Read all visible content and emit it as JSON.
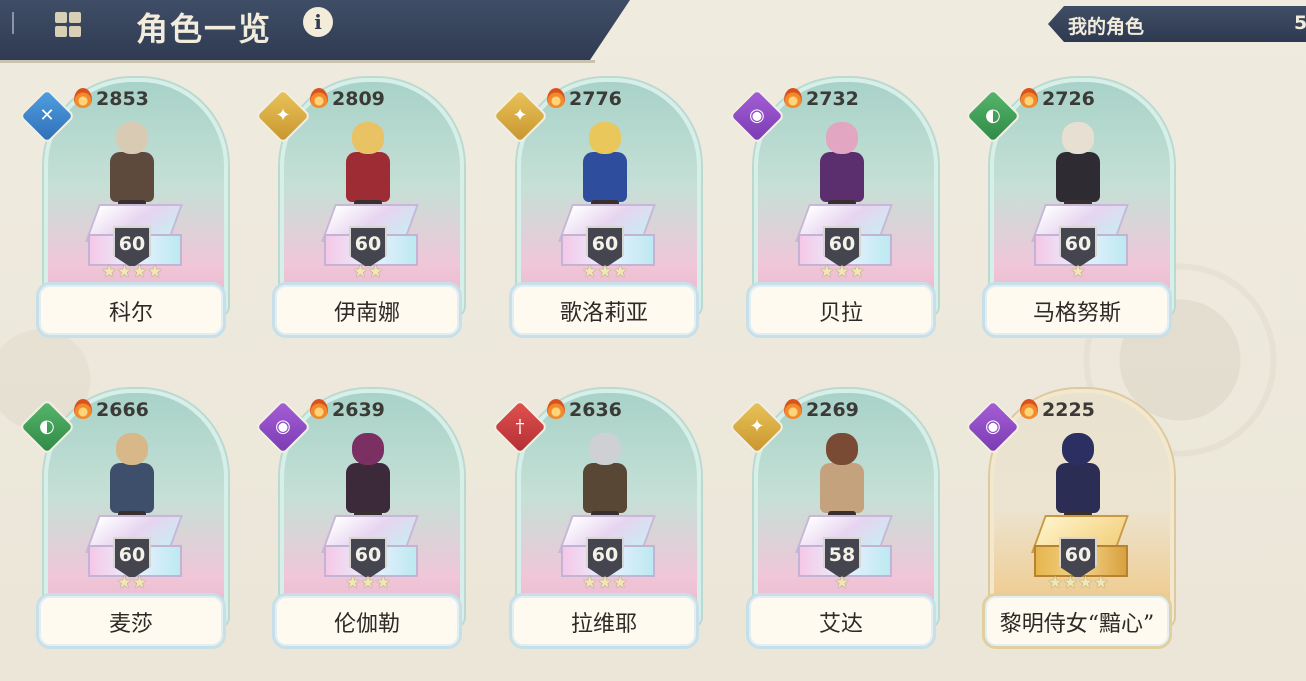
{
  "header": {
    "title": "角色一览",
    "info_icon": "info-icon",
    "menu_icon": "grid-menu-icon"
  },
  "my_characters": {
    "label": "我的角色",
    "count": "5"
  },
  "colors": {
    "header_bg": "#34405a",
    "card_teal": "#a8d2c8",
    "card_gold": "#efcf98",
    "element_wind": "#3f86cf",
    "element_light": "#d6ab43",
    "element_dark": "#8f4dc4",
    "element_earth": "#42a058",
    "element_fire": "#c93f42"
  },
  "characters": [
    {
      "name": "科尔",
      "power": "2853",
      "level": "60",
      "stars": "★★★★",
      "element": "wind",
      "hair": "#d9cbb3",
      "outfit": "#5e4a3c",
      "gold": false
    },
    {
      "name": "伊南娜",
      "power": "2809",
      "level": "60",
      "stars": "★★",
      "element": "light",
      "hair": "#e9c264",
      "outfit": "#9e2c35",
      "gold": false
    },
    {
      "name": "歌洛莉亚",
      "power": "2776",
      "level": "60",
      "stars": "★★★",
      "element": "light",
      "hair": "#e9c75a",
      "outfit": "#2e4d9c",
      "gold": false
    },
    {
      "name": "贝拉",
      "power": "2732",
      "level": "60",
      "stars": "★★★",
      "element": "dark",
      "hair": "#e2a6c2",
      "outfit": "#5b2f6e",
      "gold": false
    },
    {
      "name": "马格努斯",
      "power": "2726",
      "level": "60",
      "stars": "★",
      "element": "earth",
      "hair": "#e7dfd1",
      "outfit": "#2e2b33",
      "gold": false
    },
    {
      "name": "麦莎",
      "power": "2666",
      "level": "60",
      "stars": "★★",
      "element": "earth",
      "hair": "#d8b788",
      "outfit": "#3e4f6b",
      "gold": false
    },
    {
      "name": "伦伽勒",
      "power": "2639",
      "level": "60",
      "stars": "★★★",
      "element": "dark",
      "hair": "#7b2f63",
      "outfit": "#3c2a3a",
      "gold": false
    },
    {
      "name": "拉维耶",
      "power": "2636",
      "level": "60",
      "stars": "★★★",
      "element": "fire",
      "hair": "#cfd0d3",
      "outfit": "#584735",
      "gold": false
    },
    {
      "name": "艾达",
      "power": "2269",
      "level": "58",
      "stars": "★",
      "element": "light",
      "hair": "#7a4a35",
      "outfit": "#c4a27d",
      "gold": false
    },
    {
      "name": "黎明侍女“黯心”",
      "power": "2225",
      "level": "60",
      "stars": "★★★★",
      "element": "dark",
      "hair": "#2c2f62",
      "outfit": "#2b2d55",
      "gold": true
    }
  ]
}
